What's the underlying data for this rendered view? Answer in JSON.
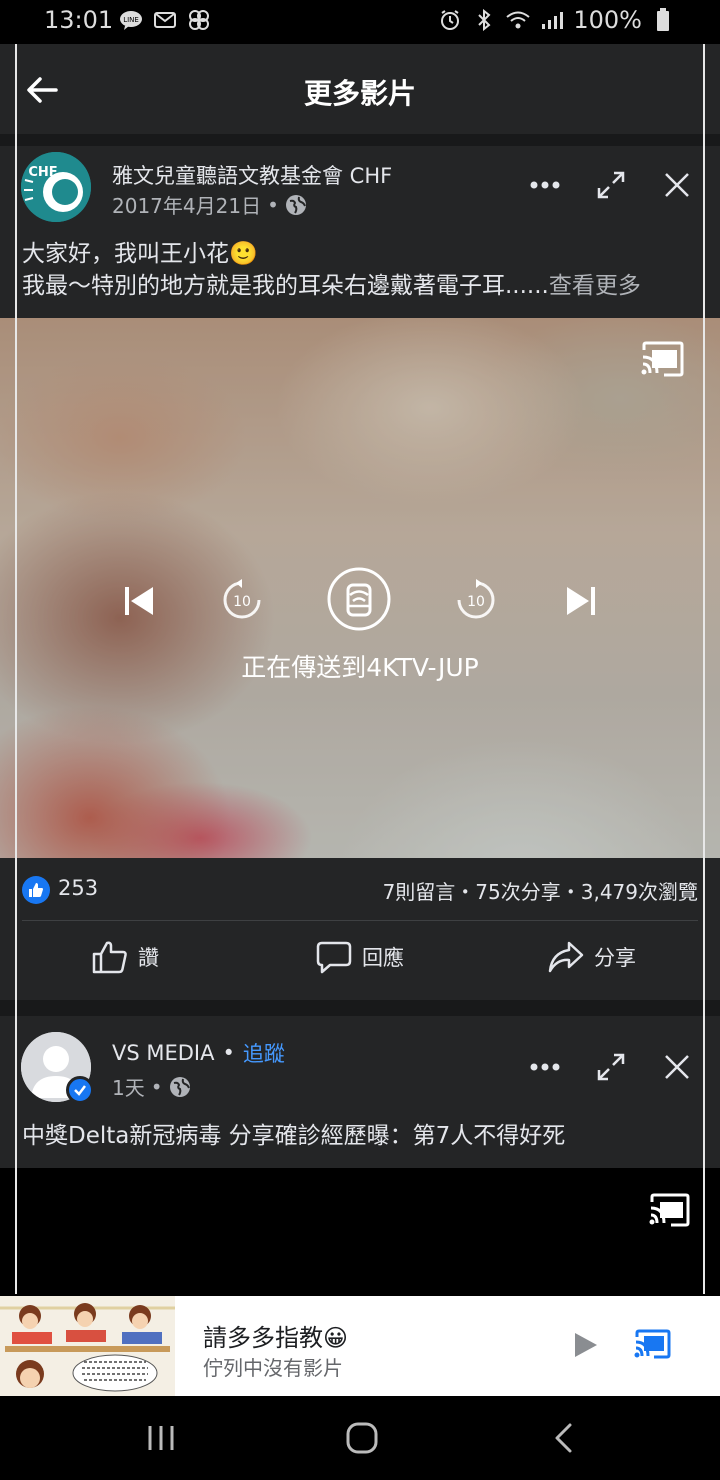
{
  "status_bar": {
    "time": "13:01",
    "battery": "100%"
  },
  "header": {
    "title": "更多影片"
  },
  "post1": {
    "page_name": "雅文兒童聽語文教基金會 CHF",
    "avatar_text": "CHF",
    "date": "2017年4月21日",
    "separator": "•",
    "caption_line1": "大家好，我叫王小花🙂",
    "caption_line2": "我最～特別的地方就是我的耳朵右邊戴著電子耳......",
    "see_more": "查看更多",
    "video": {
      "skip_back_label": "10",
      "skip_forward_label": "10",
      "casting_status": "正在傳送到4KTV-JUP"
    },
    "like_count": "253",
    "stats": "7則留言・75次分享・3,479次瀏覽",
    "actions": {
      "like": "讚",
      "comment": "回應",
      "share": "分享"
    }
  },
  "post2": {
    "page_name": "VS MEDIA",
    "separator": "•",
    "follow_label": "追蹤",
    "time_ago": "1天",
    "caption": "中獎Delta新冠病毒 分享確診經歷曝：第7人不得好死"
  },
  "mini_player": {
    "title": "請多多指教😀",
    "subtitle": "佇列中沒有影片"
  },
  "colors": {
    "accent": "#1877f2",
    "surface": "#242526",
    "background": "#18191a"
  }
}
